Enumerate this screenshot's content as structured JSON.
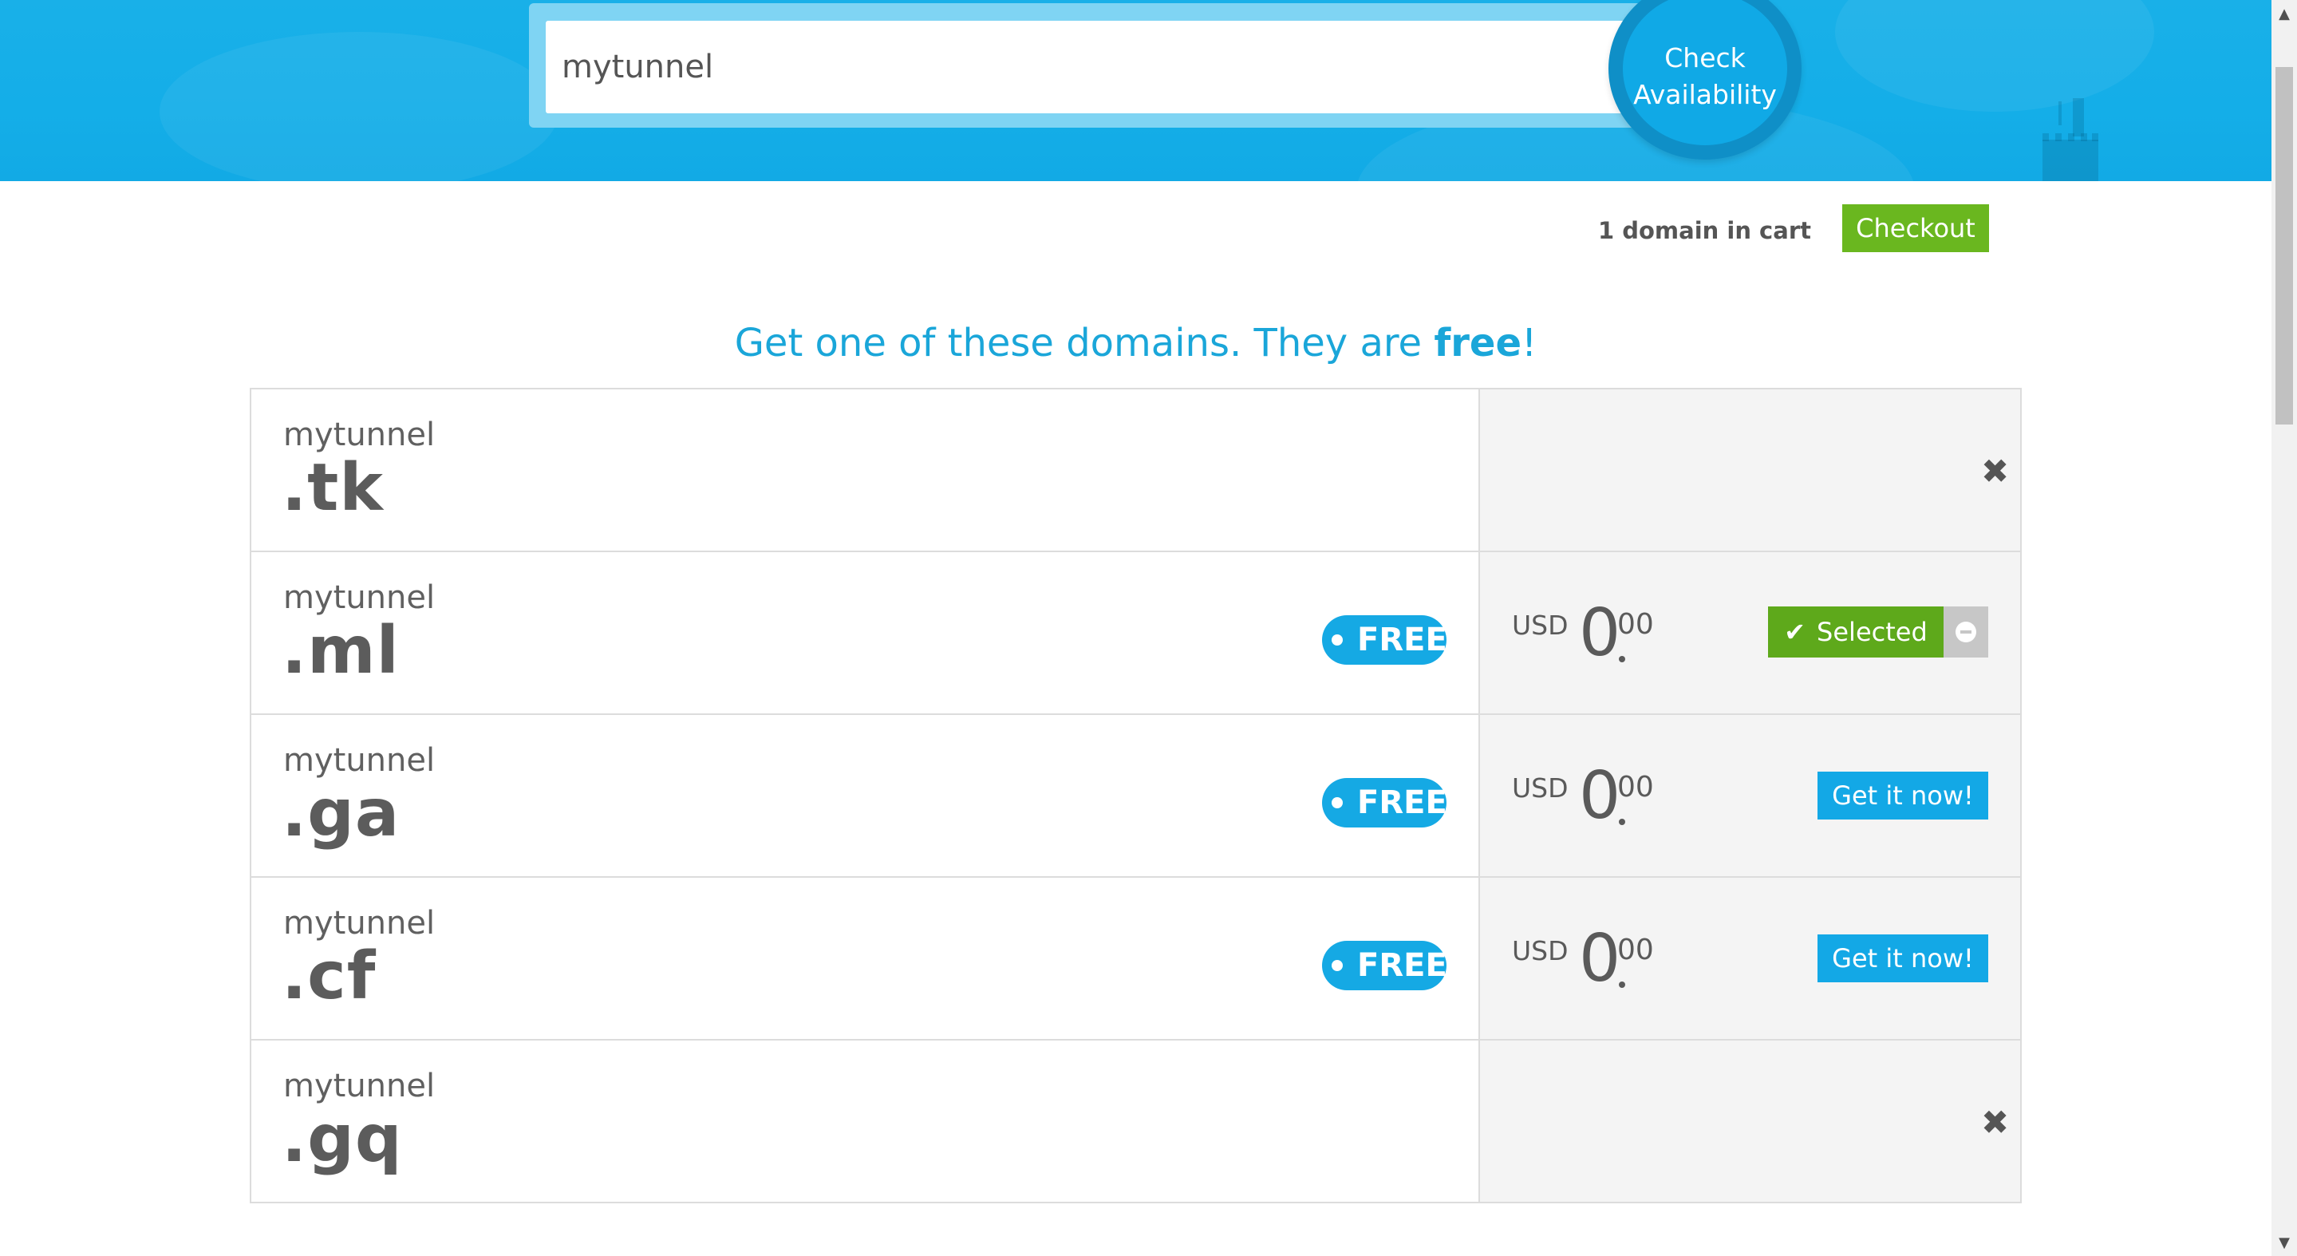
{
  "search": {
    "value": "mytunnel",
    "button_line1": "Check",
    "button_line2": "Availability"
  },
  "cart": {
    "count_text": "1 domain in cart",
    "checkout_label": "Checkout"
  },
  "promo": {
    "text": "Get one of these domains. They are ",
    "emphasis": "free",
    "suffix": "!"
  },
  "domains": [
    {
      "name": "mytunnel",
      "tld": ".tk",
      "status": "unavailable"
    },
    {
      "name": "mytunnel",
      "tld": ".ml",
      "status": "selected",
      "badge": "FREE",
      "currency": "USD",
      "price_int": "0",
      "price_dec": "00",
      "action": "Selected"
    },
    {
      "name": "mytunnel",
      "tld": ".ga",
      "status": "available",
      "badge": "FREE",
      "currency": "USD",
      "price_int": "0",
      "price_dec": "00",
      "action": "Get it now!"
    },
    {
      "name": "mytunnel",
      "tld": ".cf",
      "status": "available",
      "badge": "FREE",
      "currency": "USD",
      "price_int": "0",
      "price_dec": "00",
      "action": "Get it now!"
    },
    {
      "name": "mytunnel",
      "tld": ".gq",
      "status": "unavailable"
    }
  ],
  "icons": {
    "unavailable": "close-icon",
    "selected": "check-icon",
    "remove": "minus-circle-icon"
  },
  "colors": {
    "brand_blue": "#13a8e6",
    "green": "#6ab71f",
    "text_gray": "#5c5c5c"
  }
}
